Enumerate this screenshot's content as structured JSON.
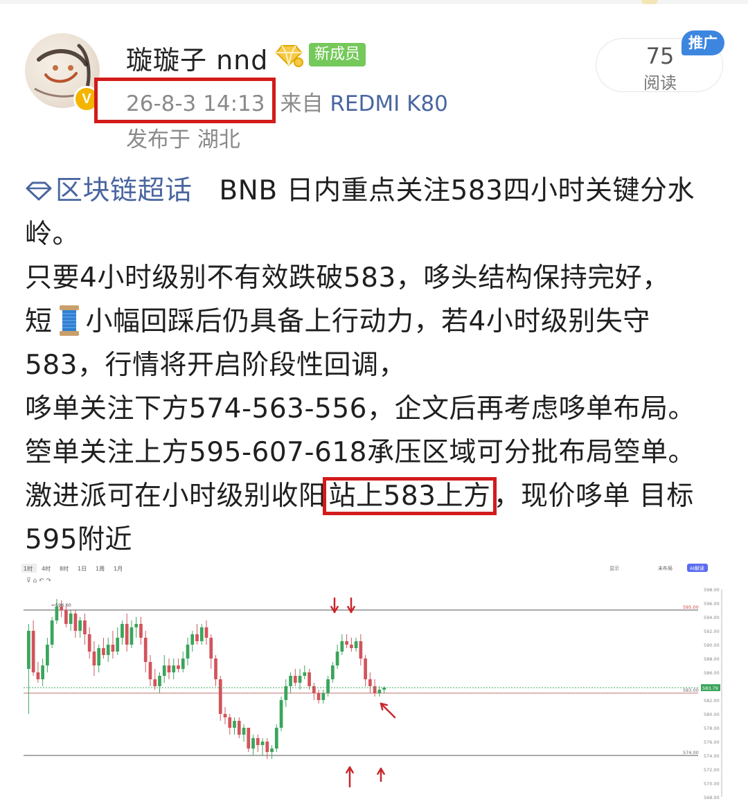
{
  "author": {
    "name": "璇璇子 nnd",
    "badge_label": "新成员",
    "verified_mark": "V"
  },
  "meta": {
    "time": "26-8-3 14:13",
    "source": "来自",
    "device": "REDMI K80",
    "location": "发布于 湖北"
  },
  "stats": {
    "reads": "75",
    "reads_label": "阅读",
    "promo_label": "推广"
  },
  "post": {
    "topic": "区块链超话",
    "lines": [
      "BNB 日内重点关注583四小时关键分水",
      "岭。",
      "只要4小时级别不有效跌破583，哆头结构保持完好，",
      "短",
      "小幅回踩后仍具备上行动力，若4小时级别失守",
      "583，行情将开启阶段性回调，",
      "哆单关注下方574-563-556，企文后再考虑哆单布局。",
      "箜单关注上方595-607-618承压区域可分批布局箜单。",
      "激进派可在小时级别收阳",
      "站上583上方",
      "，现价哆单 目标",
      "595附近"
    ]
  },
  "chart_data": {
    "type": "candlestick",
    "toolbar": {
      "intervals": [
        "1时",
        "4时",
        "8时",
        "1日",
        "1周",
        "1月"
      ],
      "active_interval": "1时",
      "right_items": [
        "显示",
        "未布局",
        "AI解读"
      ]
    },
    "ylim": [
      568,
      598
    ],
    "y_ticks": [
      "598.00",
      "596.00",
      "594.00",
      "592.00",
      "590.00",
      "588.00",
      "586.00",
      "584.00",
      "582.00",
      "580.00",
      "578.00",
      "576.00",
      "574.00",
      "572.00",
      "570.00",
      "568.00"
    ],
    "high_label": "596.60",
    "levels": [
      {
        "value": 595,
        "label": "595.00"
      },
      {
        "value": 583,
        "label": "583.00"
      },
      {
        "value": 574,
        "label": "574.00"
      }
    ],
    "current_price": "583.79",
    "candles": [
      [
        586.5,
        592.0,
        593.0,
        580.0
      ],
      [
        592.0,
        586.0,
        593.5,
        585.5
      ],
      [
        586.0,
        585.0,
        587.5,
        584.5
      ],
      [
        585.0,
        587.0,
        588.0,
        584.0
      ],
      [
        587.0,
        590.0,
        591.0,
        586.0
      ],
      [
        590.0,
        593.5,
        594.0,
        589.5
      ],
      [
        593.5,
        595.5,
        596.6,
        593.0
      ],
      [
        595.5,
        595.0,
        596.4,
        594.0
      ],
      [
        595.0,
        593.0,
        595.5,
        592.5
      ],
      [
        593.0,
        594.5,
        595.0,
        592.0
      ],
      [
        594.5,
        592.0,
        595.0,
        591.0
      ],
      [
        592.0,
        593.5,
        594.0,
        591.0
      ],
      [
        593.5,
        591.5,
        594.5,
        590.0
      ],
      [
        591.5,
        589.0,
        592.5,
        588.0
      ],
      [
        589.0,
        587.0,
        590.5,
        585.5
      ],
      [
        587.0,
        589.5,
        590.0,
        586.0
      ],
      [
        589.5,
        588.5,
        591.0,
        588.0
      ],
      [
        588.5,
        590.0,
        591.0,
        587.5
      ],
      [
        590.0,
        589.0,
        592.0,
        588.0
      ],
      [
        589.0,
        591.0,
        592.5,
        588.5
      ],
      [
        591.0,
        593.0,
        593.5,
        590.0
      ],
      [
        593.0,
        590.0,
        594.5,
        589.0
      ],
      [
        590.0,
        592.5,
        593.5,
        589.5
      ],
      [
        592.5,
        593.0,
        594.0,
        591.0
      ],
      [
        593.0,
        591.0,
        594.0,
        590.0
      ],
      [
        591.0,
        587.5,
        592.0,
        586.0
      ],
      [
        587.5,
        585.0,
        588.5,
        584.0
      ],
      [
        585.0,
        584.0,
        586.5,
        583.5
      ],
      [
        584.0,
        585.5,
        586.0,
        583.0
      ],
      [
        585.5,
        587.0,
        588.5,
        584.5
      ],
      [
        587.0,
        586.0,
        588.0,
        585.0
      ],
      [
        586.0,
        587.0,
        588.0,
        585.0
      ],
      [
        587.0,
        586.5,
        588.0,
        586.0
      ],
      [
        586.5,
        588.0,
        589.0,
        586.0
      ],
      [
        588.0,
        590.0,
        591.0,
        587.0
      ],
      [
        590.0,
        591.5,
        592.0,
        589.0
      ],
      [
        591.5,
        590.5,
        593.0,
        590.0
      ],
      [
        590.5,
        592.5,
        593.0,
        590.0
      ],
      [
        592.5,
        591.0,
        593.5,
        590.0
      ],
      [
        591.0,
        588.0,
        591.5,
        586.5
      ],
      [
        588.0,
        585.0,
        588.5,
        584.0
      ],
      [
        585.0,
        580.0,
        585.5,
        579.0
      ],
      [
        580.0,
        579.5,
        581.0,
        578.5
      ],
      [
        579.5,
        578.0,
        580.0,
        577.0
      ],
      [
        578.0,
        579.0,
        579.5,
        577.0
      ],
      [
        579.0,
        577.0,
        579.5,
        576.5
      ],
      [
        577.0,
        578.0,
        578.5,
        576.0
      ],
      [
        578.0,
        575.0,
        578.0,
        574.5
      ],
      [
        575.0,
        576.5,
        577.0,
        574.0
      ],
      [
        576.5,
        575.5,
        577.0,
        574.5
      ],
      [
        575.5,
        576.0,
        576.5,
        574.0
      ],
      [
        576.0,
        574.5,
        576.5,
        573.5
      ],
      [
        574.5,
        575.0,
        575.5,
        573.5
      ],
      [
        575.0,
        578.0,
        578.5,
        574.5
      ],
      [
        578.0,
        582.0,
        582.5,
        577.5
      ],
      [
        582.0,
        584.0,
        585.0,
        581.0
      ],
      [
        584.0,
        585.5,
        586.0,
        583.0
      ],
      [
        585.5,
        584.5,
        586.5,
        584.0
      ],
      [
        584.5,
        585.5,
        586.5,
        583.5
      ],
      [
        585.5,
        586.0,
        587.0,
        585.0
      ],
      [
        586.0,
        584.0,
        586.5,
        583.5
      ],
      [
        584.0,
        583.0,
        584.5,
        582.0
      ],
      [
        583.0,
        582.0,
        583.5,
        581.5
      ],
      [
        582.0,
        583.0,
        583.5,
        581.5
      ],
      [
        583.0,
        585.0,
        585.5,
        582.5
      ],
      [
        585.0,
        587.0,
        587.5,
        584.5
      ],
      [
        587.0,
        589.0,
        590.0,
        586.5
      ],
      [
        589.0,
        590.5,
        591.5,
        588.5
      ],
      [
        590.5,
        590.0,
        591.5,
        589.5
      ],
      [
        590.0,
        589.5,
        591.0,
        589.0
      ],
      [
        589.5,
        590.5,
        591.0,
        589.0
      ],
      [
        590.5,
        588.0,
        591.5,
        587.0
      ],
      [
        588.0,
        585.0,
        588.5,
        584.0
      ],
      [
        585.0,
        584.0,
        586.0,
        583.0
      ],
      [
        584.0,
        583.0,
        585.0,
        582.5
      ],
      [
        583.0,
        583.5,
        584.0,
        582.5
      ],
      [
        583.5,
        583.79,
        584.0,
        583.0
      ]
    ]
  }
}
